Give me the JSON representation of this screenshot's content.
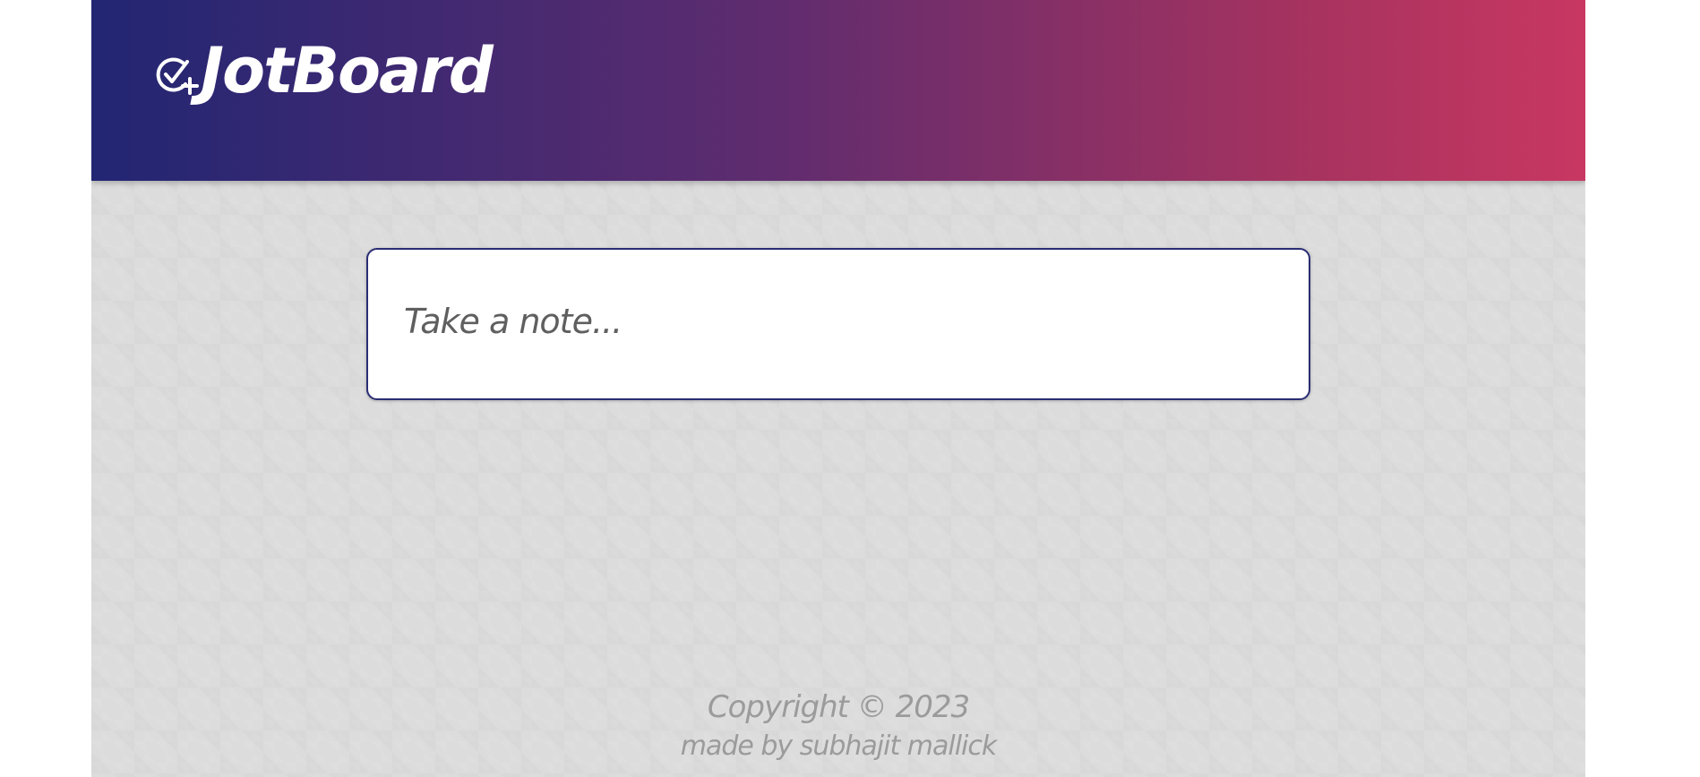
{
  "header": {
    "brand_name": "JotBoard",
    "brand_icon": "check-plus-circle-icon",
    "gradient_start": "#222673",
    "gradient_end": "#c83762"
  },
  "note": {
    "placeholder": "Take a note...",
    "value": ""
  },
  "footer": {
    "copyright": "Copyright © 2023",
    "made_by": "made by subhajit mallick"
  }
}
